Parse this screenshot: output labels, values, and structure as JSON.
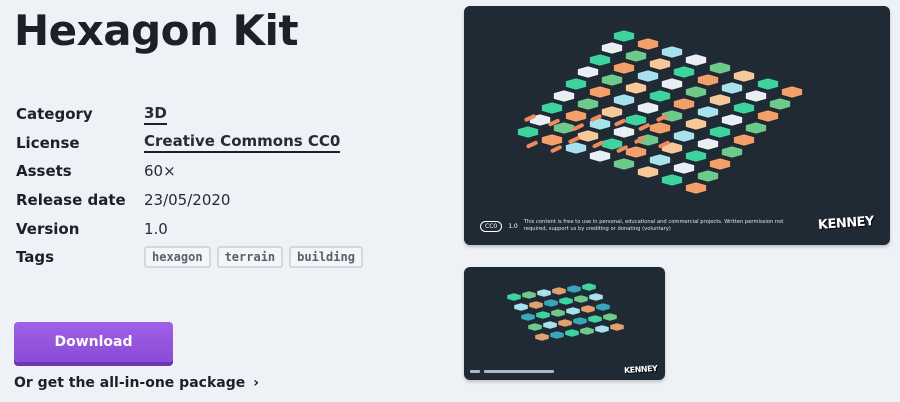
{
  "title": "Hexagon Kit",
  "meta": {
    "category_label": "Category",
    "category_value": "3D",
    "license_label": "License",
    "license_value": "Creative Commons CC0",
    "assets_label": "Assets",
    "assets_value": "60×",
    "release_label": "Release date",
    "release_value": "23/05/2020",
    "version_label": "Version",
    "version_value": "1.0",
    "tags_label": "Tags",
    "tags": [
      "hexagon",
      "terrain",
      "building"
    ]
  },
  "download_label": "Download",
  "allinone_label": "Or get the all-in-one package",
  "allinone_chevron": "›",
  "preview": {
    "cc_badge": "CC0",
    "cc_version": "1.0",
    "cc_text": "This content is free to use in personal, educational and commercial projects. Written permission not required, support us by crediting or donating (voluntary)",
    "brand": "KENNEY"
  },
  "colors": {
    "accent": "#9a58e6",
    "preview_bg": "#202a35"
  },
  "icons": [
    "chevron-right-icon",
    "cc-badge-icon"
  ]
}
